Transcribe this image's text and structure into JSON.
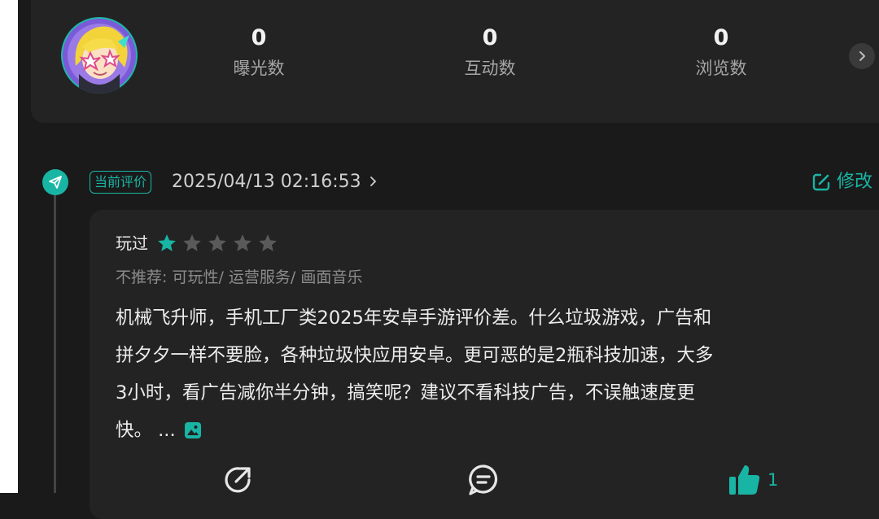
{
  "stats": [
    {
      "value": "0",
      "label": "曝光数"
    },
    {
      "value": "0",
      "label": "互动数"
    },
    {
      "value": "0",
      "label": "浏览数"
    }
  ],
  "evaluation": {
    "tag": "当前评价",
    "datetime": "2025/04/13 02:16:53",
    "edit_label": "修改"
  },
  "review": {
    "played_label": "玩过",
    "rating": 1,
    "max_rating": 5,
    "tags_line": "不推荐: 可玩性/ 运营服务/ 画面音乐",
    "lines": [
      "机械飞升师，手机工厂类2025年安卓手游评价差。什么垃圾游戏，广告和",
      "拼夕夕一样不要脸，各种垃圾快应用安卓。更可恶的是2瓶科技加速，大多",
      "3小时，看广告减你半分钟，搞笑呢？建议不看科技广告，不误触速度更",
      "快。 ..."
    ],
    "like_count": "1"
  },
  "colors": {
    "accent": "#19b5a4",
    "background": "#1a1a1a",
    "card": "#232323",
    "star_empty": "#5a5a5a"
  },
  "icons": {
    "stats_more": "chevron-right-icon",
    "timeline": "send-icon",
    "edit": "edit-icon",
    "review_image": "image-icon",
    "share": "share-icon",
    "comment": "comment-icon",
    "like": "thumbs-up-icon"
  }
}
